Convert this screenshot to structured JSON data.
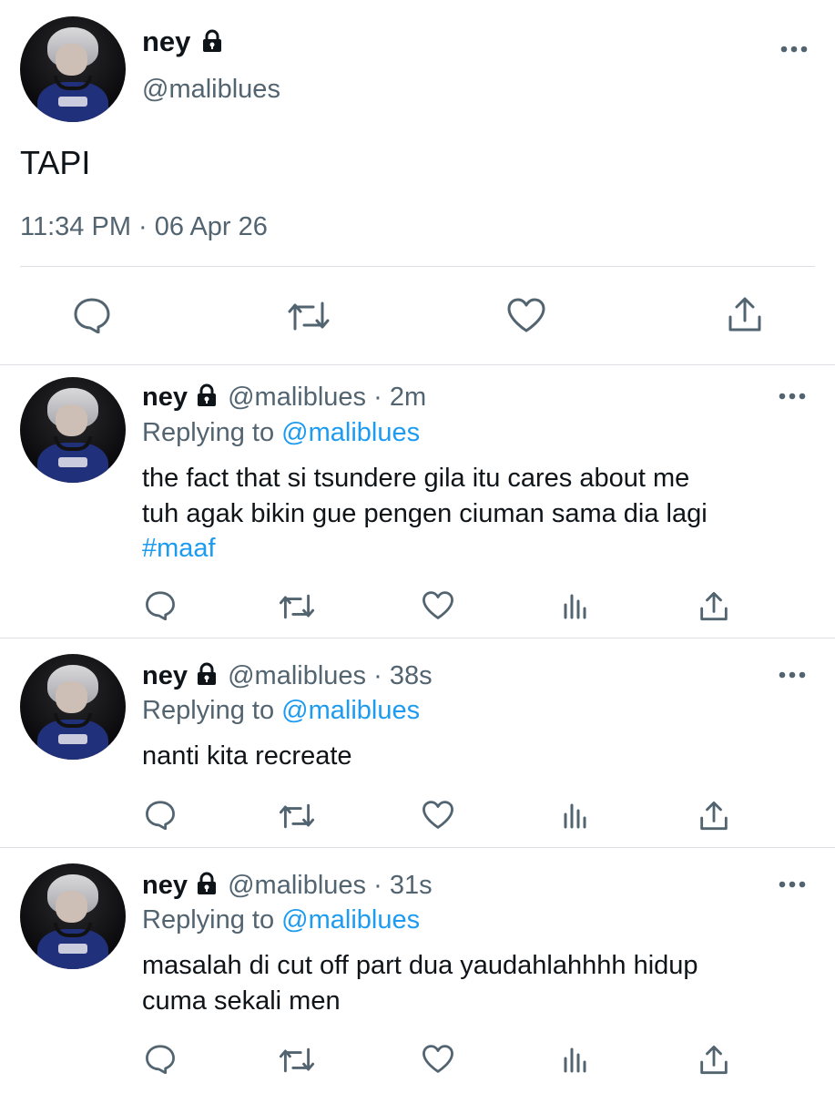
{
  "main_tweet": {
    "name": "ney",
    "handle": "@maliblues",
    "text": "TAPI",
    "timestamp": "11:34 PM · 06 Apr 26"
  },
  "replies": [
    {
      "name": "ney",
      "handle": "@maliblues",
      "time": "· 2m",
      "replying_label": "Replying to",
      "replying_to": "@maliblues",
      "line1": "the fact that si tsundere gila itu cares about me",
      "line2": "tuh agak bikin gue pengen ciuman sama dia lagi",
      "hashtag": "#maaf"
    },
    {
      "name": "ney",
      "handle": "@maliblues",
      "time": "· 38s",
      "replying_label": "Replying to",
      "replying_to": "@maliblues",
      "line1": "nanti kita recreate"
    },
    {
      "name": "ney",
      "handle": "@maliblues",
      "time": "· 31s",
      "replying_label": "Replying to",
      "replying_to": "@maliblues",
      "line1": "masalah di cut off part dua yaudahlahhhh hidup",
      "line2": "cuma sekali men"
    }
  ],
  "icons": [
    "lock-icon",
    "more-icon",
    "reply-icon",
    "retweet-icon",
    "like-icon",
    "analytics-icon",
    "share-icon"
  ],
  "colors": {
    "text": "#0f1419",
    "secondary": "#536471",
    "link": "#1d9bf0",
    "divider": "#dcdfe3"
  }
}
